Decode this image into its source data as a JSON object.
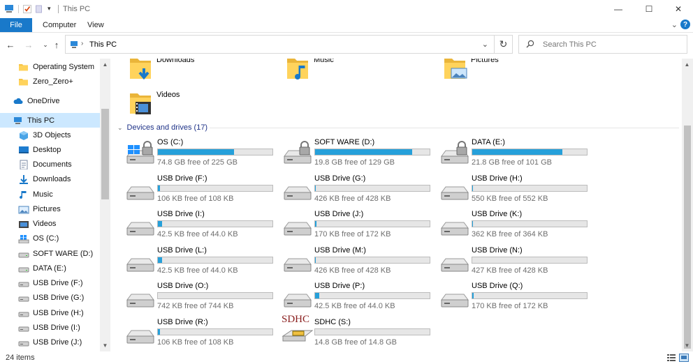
{
  "window": {
    "title": "This PC",
    "minimize": "—",
    "maximize": "☐",
    "close": "✕"
  },
  "ribbon": {
    "tabs": [
      "File",
      "Computer",
      "View"
    ],
    "expand": "⌄",
    "help": "?"
  },
  "address": {
    "path": "This PC",
    "search_placeholder": "Search This PC"
  },
  "nav_pane": [
    {
      "label": "Operating System",
      "icon": "folder-icon"
    },
    {
      "label": "Zero_Zero+",
      "icon": "folder-icon"
    },
    {
      "label": "OneDrive",
      "icon": "cloud-icon"
    },
    {
      "label": "This PC",
      "icon": "computer-icon",
      "selected": true
    },
    {
      "label": "3D Objects",
      "icon": "cube-icon"
    },
    {
      "label": "Desktop",
      "icon": "desktop-icon"
    },
    {
      "label": "Documents",
      "icon": "document-icon"
    },
    {
      "label": "Downloads",
      "icon": "download-icon"
    },
    {
      "label": "Music",
      "icon": "music-icon"
    },
    {
      "label": "Pictures",
      "icon": "picture-icon"
    },
    {
      "label": "Videos",
      "icon": "video-icon"
    },
    {
      "label": "OS (C:)",
      "icon": "windows-drive-icon"
    },
    {
      "label": "SOFT WARE (D:)",
      "icon": "drive-icon"
    },
    {
      "label": "DATA (E:)",
      "icon": "drive-icon"
    },
    {
      "label": "USB Drive (F:)",
      "icon": "usb-drive-icon"
    },
    {
      "label": "USB Drive (G:)",
      "icon": "usb-drive-icon"
    },
    {
      "label": "USB Drive (H:)",
      "icon": "usb-drive-icon"
    },
    {
      "label": "USB Drive (I:)",
      "icon": "usb-drive-icon"
    },
    {
      "label": "USB Drive (J:)",
      "icon": "usb-drive-icon"
    }
  ],
  "folders": [
    {
      "label": "Downloads",
      "icon": "downloads-folder-icon"
    },
    {
      "label": "Music",
      "icon": "music-folder-icon"
    },
    {
      "label": "Pictures",
      "icon": "pictures-folder-icon"
    },
    {
      "label": "Videos",
      "icon": "videos-folder-icon"
    }
  ],
  "devices_header": "Devices and drives (17)",
  "drives": [
    {
      "name": "OS (C:)",
      "free": "74.8 GB free of 225 GB",
      "used": 0.667,
      "icon": "windows-locked-drive-icon"
    },
    {
      "name": "SOFT WARE (D:)",
      "free": "19.8 GB free of 129 GB",
      "used": 0.846,
      "icon": "locked-drive-icon"
    },
    {
      "name": "DATA (E:)",
      "free": "21.8 GB free of 101 GB",
      "used": 0.784,
      "icon": "locked-drive-icon"
    },
    {
      "name": "USB Drive (F:)",
      "free": "106 KB free of 108 KB",
      "used": 0.02,
      "icon": "usb-drive-icon"
    },
    {
      "name": "USB Drive (G:)",
      "free": "426 KB free of 428 KB",
      "used": 0.005,
      "icon": "usb-drive-icon"
    },
    {
      "name": "USB Drive (H:)",
      "free": "550 KB free of 552 KB",
      "used": 0.004,
      "icon": "usb-drive-icon"
    },
    {
      "name": "USB Drive (I:)",
      "free": "42.5 KB free of 44.0 KB",
      "used": 0.034,
      "icon": "usb-drive-icon"
    },
    {
      "name": "USB Drive (J:)",
      "free": "170 KB free of 172 KB",
      "used": 0.012,
      "icon": "usb-drive-icon"
    },
    {
      "name": "USB Drive (K:)",
      "free": "362 KB free of 364 KB",
      "used": 0.006,
      "icon": "usb-drive-icon"
    },
    {
      "name": "USB Drive (L:)",
      "free": "42.5 KB free of 44.0 KB",
      "used": 0.034,
      "icon": "usb-drive-icon"
    },
    {
      "name": "USB Drive (M:)",
      "free": "426 KB free of 428 KB",
      "used": 0.005,
      "icon": "usb-drive-icon"
    },
    {
      "name": "USB Drive (N:)",
      "free": "427 KB free of 428 KB",
      "used": 0.003,
      "icon": "usb-drive-icon"
    },
    {
      "name": "USB Drive (O:)",
      "free": "742 KB free of 744 KB",
      "used": 0.003,
      "icon": "usb-drive-icon"
    },
    {
      "name": "USB Drive (P:)",
      "free": "42.5 KB free of 44.0 KB",
      "used": 0.034,
      "icon": "usb-drive-icon"
    },
    {
      "name": "USB Drive (Q:)",
      "free": "170 KB free of 172 KB",
      "used": 0.012,
      "icon": "usb-drive-icon"
    },
    {
      "name": "USB Drive (R:)",
      "free": "106 KB free of 108 KB",
      "used": 0.02,
      "icon": "usb-drive-icon"
    },
    {
      "name": "SDHC (S:)",
      "free": "14.8 GB free of 14.8 GB",
      "used": 0.0,
      "icon": "sdhc-card-icon",
      "logo": "SDHC"
    }
  ],
  "status": {
    "items": "24 items"
  },
  "colors": {
    "accent": "#1979ca",
    "bar_fill": "#26a0da",
    "selection": "#cce8ff",
    "group_header": "#1e3287"
  }
}
